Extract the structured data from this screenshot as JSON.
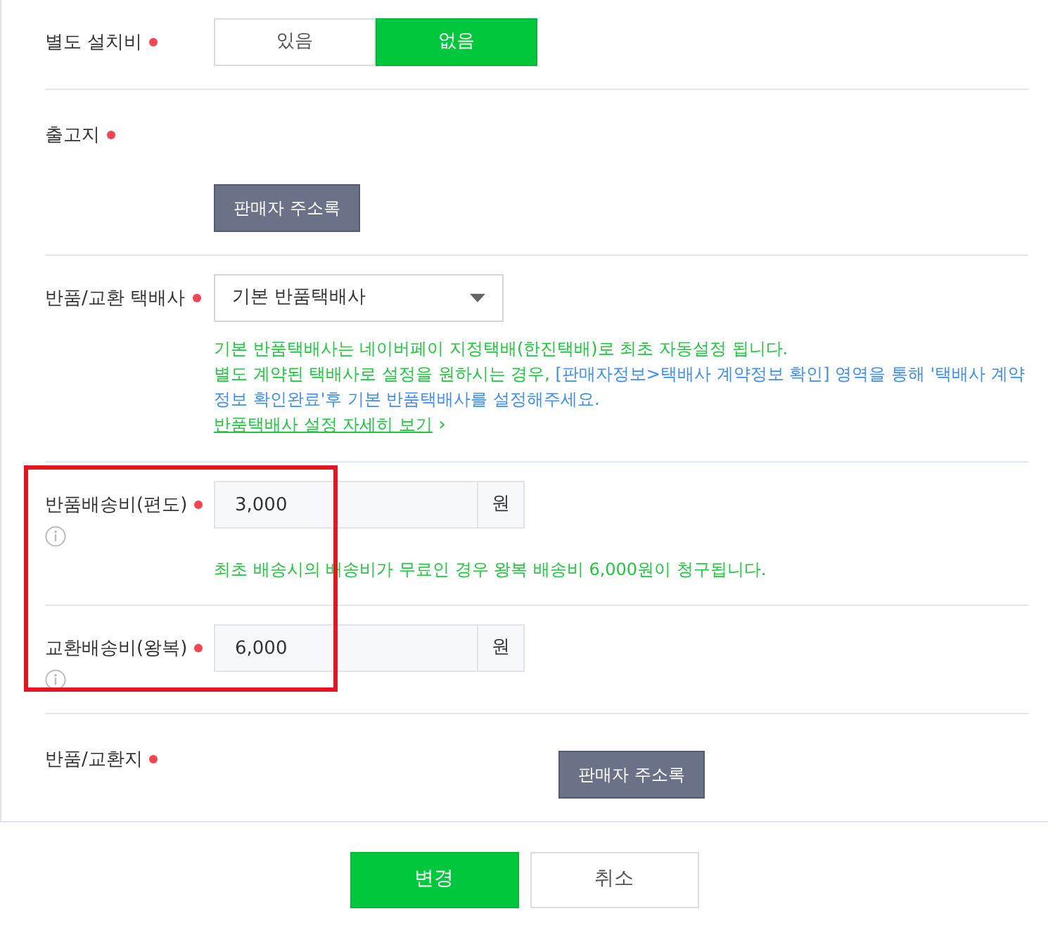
{
  "rows": [
    {
      "kind": "toggle",
      "label": "별도 설치비",
      "required": true,
      "highlighted": false,
      "options": [
        {
          "label": "있음",
          "selected": false
        },
        {
          "label": "없음",
          "selected": true
        }
      ]
    },
    {
      "kind": "address-below",
      "label": "출고지",
      "required": true,
      "highlighted": false,
      "button": "판매자 주소록"
    },
    {
      "kind": "select",
      "label": "반품/교환 택배사",
      "required": true,
      "highlighted": false,
      "value": "기본 반품택배사",
      "help": [
        [
          {
            "text": "기본 반품택배사는 네이버페이 지정택배(한진택배)로 최초 자동설정 됩니다.",
            "color": "#1ec83c"
          }
        ],
        [
          {
            "text": "별도 계약된 택배사로 설정을 원하시는 경우, ",
            "color": "#1ec83c"
          },
          {
            "text": "[판매자정보>택배사 계약정보 확인] 영역을 통해 '택배사 계약정보 확인완료'후 기본 반품택배사를 설정해주세요.",
            "color": "#3e8ef7"
          }
        ]
      ],
      "link": "반품택배사 설정 자세히 보기",
      "link_arrow": "›"
    },
    {
      "kind": "amount",
      "label": "반품배송비(편도)",
      "required": true,
      "highlighted": true,
      "info": true,
      "value": "3,000",
      "unit": "원",
      "note": "최초 배송시의 배송비가 무료인 경우 왕복 배송비 6,000원이 청구됩니다."
    },
    {
      "kind": "amount",
      "label": "교환배송비(왕복)",
      "required": true,
      "highlighted": true,
      "info": true,
      "value": "6,000",
      "unit": "원"
    },
    {
      "kind": "address-inline",
      "label": "반품/교환지",
      "required": true,
      "highlighted": false,
      "button": "판매자 주소록"
    }
  ],
  "actions": [
    {
      "label": "변경",
      "primary": true
    },
    {
      "label": "취소",
      "primary": false
    }
  ]
}
